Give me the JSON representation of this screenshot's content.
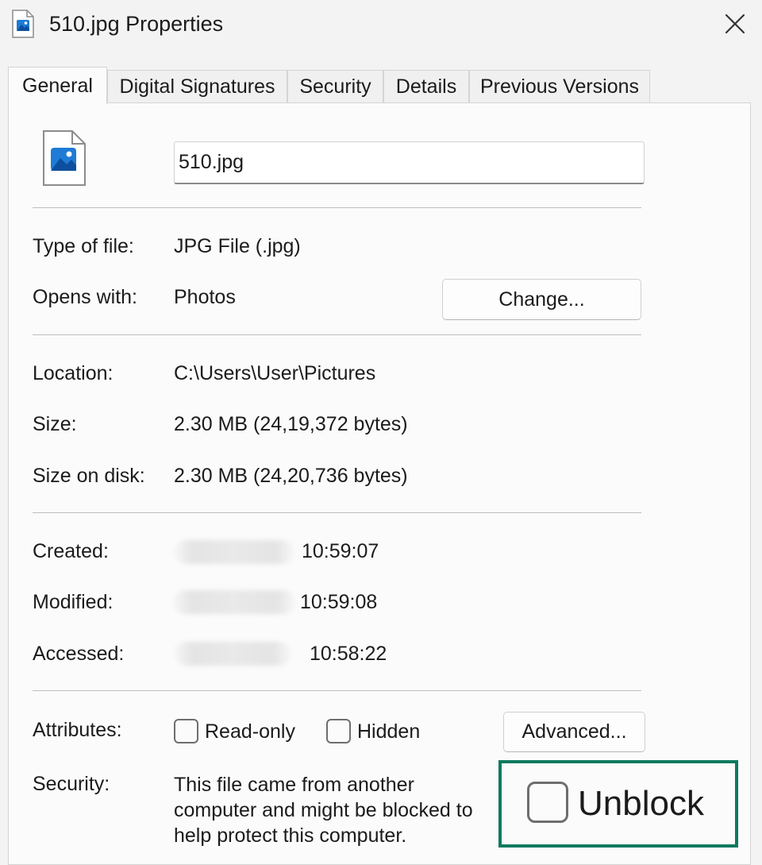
{
  "window": {
    "title": "510.jpg Properties",
    "title_icon": "image-file-icon",
    "close_icon": "close-icon"
  },
  "tabs": [
    {
      "label": "General",
      "active": true
    },
    {
      "label": "Digital Signatures",
      "active": false
    },
    {
      "label": "Security",
      "active": false
    },
    {
      "label": "Details",
      "active": false
    },
    {
      "label": "Previous Versions",
      "active": false
    }
  ],
  "general": {
    "file_icon": "image-file-icon",
    "file_name": "510.jpg",
    "type_label": "Type of file:",
    "type_value": "JPG File (.jpg)",
    "opens_label": "Opens with:",
    "opens_value": "Photos",
    "change_button": "Change...",
    "location_label": "Location:",
    "location_value": "C:\\Users\\User\\Pictures",
    "size_label": "Size:",
    "size_value": "2.30 MB (24,19,372 bytes)",
    "size_disk_label": "Size on disk:",
    "size_disk_value": "2.30 MB (24,20,736 bytes)",
    "created_label": "Created:",
    "created_time": "10:59:07",
    "modified_label": "Modified:",
    "modified_time": "10:59:08",
    "accessed_label": "Accessed:",
    "accessed_time": "10:58:22",
    "attributes_label": "Attributes:",
    "readonly_label": "Read-only",
    "readonly_checked": false,
    "hidden_label": "Hidden",
    "hidden_checked": false,
    "advanced_button": "Advanced...",
    "security_label": "Security:",
    "security_text": "This file came from another computer and might be blocked to help protect this computer.",
    "unblock_label": "Unblock",
    "unblock_checked": false
  },
  "colors": {
    "highlight_border": "#0e7a5e",
    "icon_blue": "#1f7bd6"
  }
}
